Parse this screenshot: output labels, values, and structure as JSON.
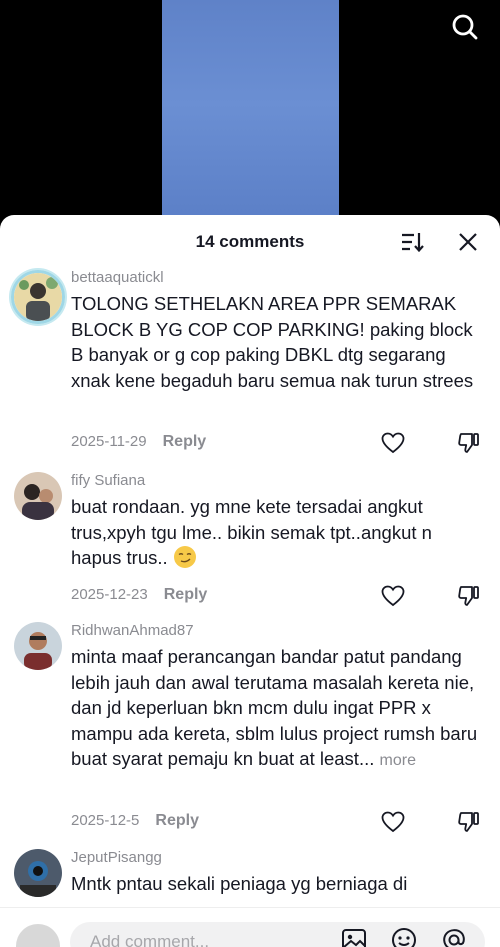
{
  "top": {
    "search_icon": "search-icon"
  },
  "sheet": {
    "count_label": "14 comments",
    "sort_icon": "sort-icon",
    "close_icon": "close-icon"
  },
  "comments": [
    {
      "username": "bettaaquatickl",
      "text": "TOLONG SETHELAKN AREA PPR SEMARAK BLOCK B YG COP COP PARKING! paking block B banyak or g cop paking DBKL dtg segarang xnak kene begaduh baru semua nak turun strees",
      "date": "2025-11-29",
      "reply_label": "Reply"
    },
    {
      "username": "fify Sufiana",
      "text": "buat rondaan. yg mne kete tersadai angkut trus,xpyh tgu lme.. bikin semak tpt..angkut n hapus trus..",
      "emoji": "smirk-emoji",
      "date": "2025-12-23",
      "reply_label": "Reply"
    },
    {
      "username": "RidhwanAhmad87",
      "text": "minta maaf perancangan bandar patut pandang lebih jauh dan awal terutama masalah kereta nie, dan jd keperluan bkn mcm dulu ingat PPR x mampu ada kereta, sblm lulus project rumsh baru buat syarat pemaju kn buat at least...",
      "more_label": "more",
      "date": "2025-12-5",
      "reply_label": "Reply"
    },
    {
      "username": "JeputPisangg",
      "text": "Mntk pntau sekali peniaga yg berniaga di"
    }
  ],
  "input": {
    "placeholder": "Add comment...",
    "icons": [
      "image-icon",
      "emoji-icon",
      "mention-icon"
    ]
  }
}
